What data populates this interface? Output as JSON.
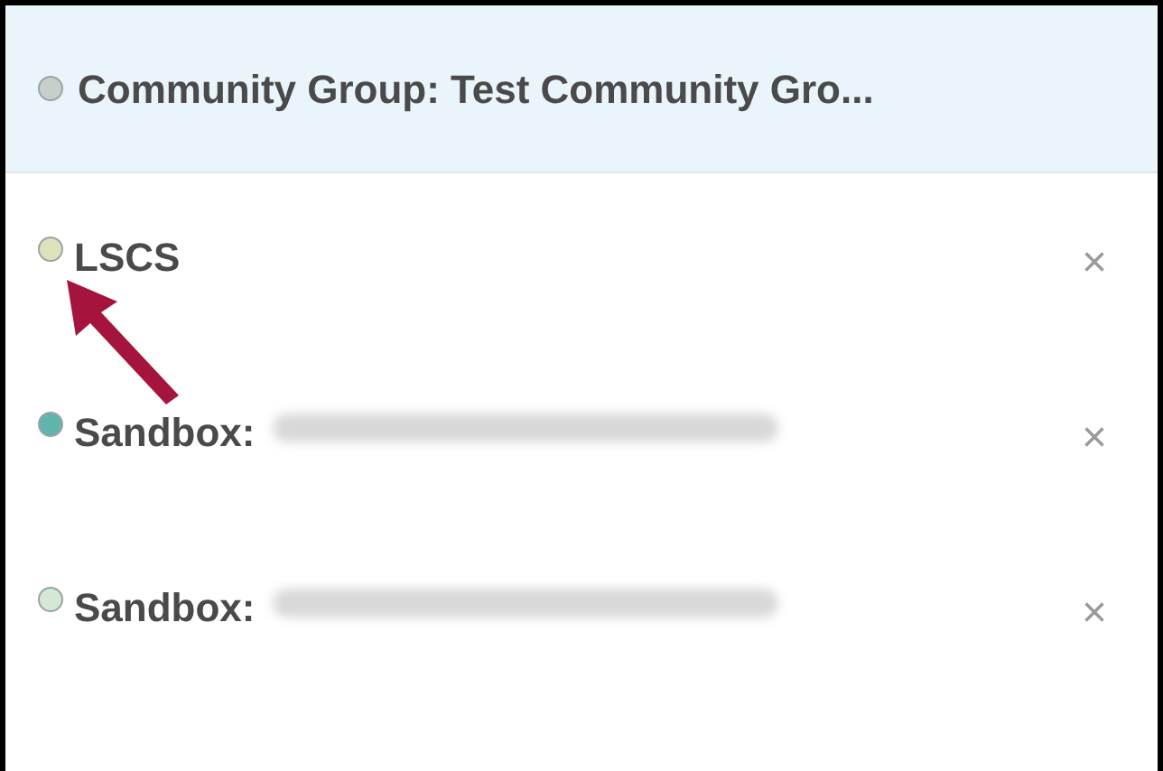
{
  "header": {
    "title": "Community Group: Test Community Gro...",
    "color": "#c6cfcc"
  },
  "items": [
    {
      "label": "LSCS",
      "color": "#dde2bd",
      "blurred": false,
      "close": "×"
    },
    {
      "label": "Sandbox:",
      "color": "#5fb5ad",
      "blurred": true,
      "close": "×"
    },
    {
      "label": "Sandbox:",
      "color": "#d5e8d7",
      "blurred": true,
      "close": "×"
    }
  ],
  "annotation": {
    "kind": "arrow"
  }
}
